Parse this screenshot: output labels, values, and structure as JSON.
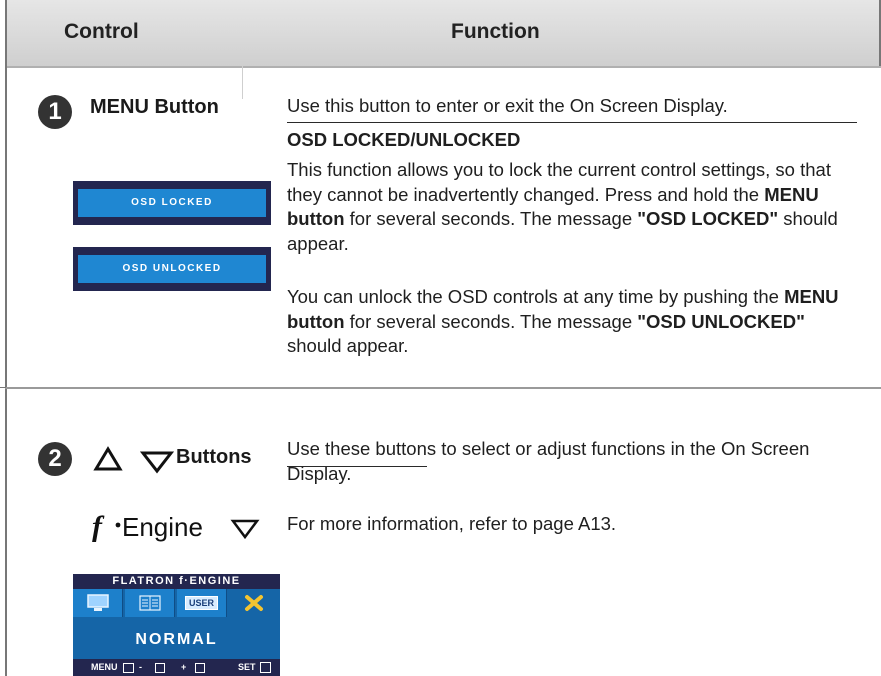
{
  "header": {
    "control": "Control",
    "function": "Function"
  },
  "row1": {
    "number": "1",
    "control_label": "MENU Button",
    "osd_locked": "OSD LOCKED",
    "osd_unlocked": "OSD UNLOCKED",
    "summary": "Use this button to enter or exit the On Screen Display.",
    "section_title": "OSD LOCKED/UNLOCKED",
    "para1": {
      "t1": "This function allows you to lock the current control settings, so that they cannot be inadvertently changed. Press and hold the ",
      "b1": "MENU button",
      "t2": " for several seconds. The message ",
      "b2": "\"OSD LOCKED\"",
      "t3": " should appear."
    },
    "para2": {
      "t1": "You can unlock the OSD controls at any time by pushing the ",
      "b1": "MENU button",
      "t2": " for several seconds. The message ",
      "b2": "\"OSD UNLOCKED\"",
      "t3": " should appear."
    }
  },
  "row2": {
    "number": "2",
    "control_label": "Buttons",
    "description": "Use these buttons to select or adjust functions in the On Screen Display.",
    "fengine_label": "Engine",
    "fengine_desc": "For more information, refer to page A13.",
    "osd": {
      "header": "FLATRON  f·ENGINE",
      "user_tile": "USER",
      "mode": "NORMAL",
      "footer": {
        "menu": "MENU",
        "minus": "-",
        "plus": "+",
        "set": "SET"
      }
    }
  }
}
